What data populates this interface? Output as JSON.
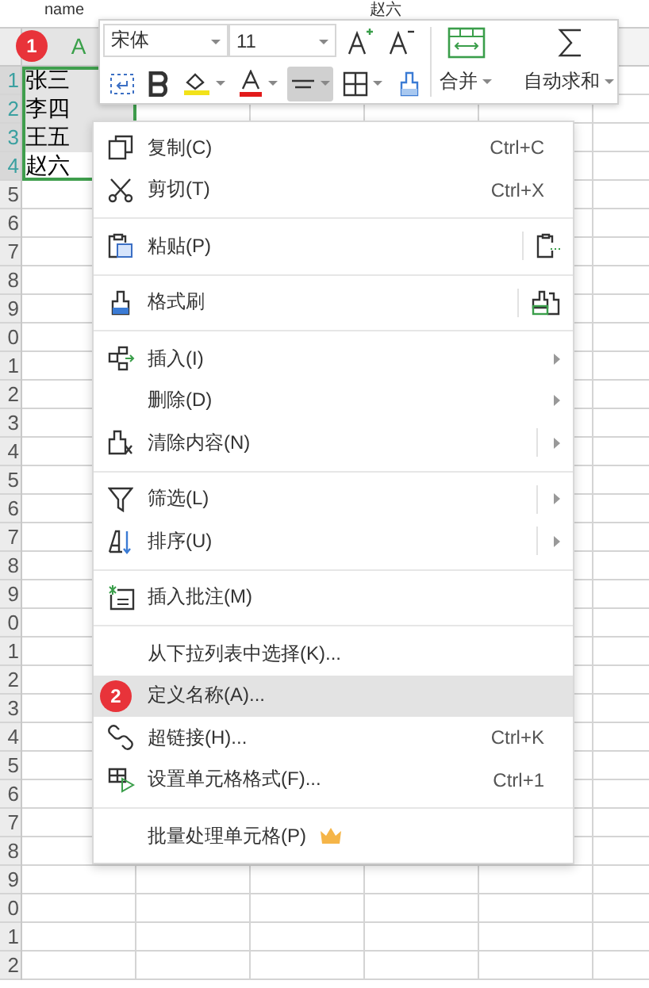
{
  "formula_bar": {
    "name_box": "name",
    "cell_content": "赵六"
  },
  "sheet": {
    "columns": [
      {
        "label": "A",
        "selected": true
      }
    ],
    "row_headers": [
      {
        "label": "1",
        "selected": true
      },
      {
        "label": "2",
        "selected": true
      },
      {
        "label": "3",
        "selected": true
      },
      {
        "label": "4",
        "selected": true
      },
      {
        "label": "5",
        "selected": false
      },
      {
        "label": "6",
        "selected": false
      },
      {
        "label": "7",
        "selected": false
      },
      {
        "label": "8",
        "selected": false
      },
      {
        "label": "9",
        "selected": false
      },
      {
        "label": "0",
        "selected": false
      },
      {
        "label": "1",
        "selected": false
      },
      {
        "label": "2",
        "selected": false
      },
      {
        "label": "3",
        "selected": false
      },
      {
        "label": "4",
        "selected": false
      },
      {
        "label": "5",
        "selected": false
      },
      {
        "label": "6",
        "selected": false
      },
      {
        "label": "7",
        "selected": false
      },
      {
        "label": "8",
        "selected": false
      },
      {
        "label": "9",
        "selected": false
      },
      {
        "label": "0",
        "selected": false
      },
      {
        "label": "1",
        "selected": false
      },
      {
        "label": "2",
        "selected": false
      },
      {
        "label": "3",
        "selected": false
      },
      {
        "label": "4",
        "selected": false
      },
      {
        "label": "5",
        "selected": false
      },
      {
        "label": "6",
        "selected": false
      },
      {
        "label": "7",
        "selected": false
      },
      {
        "label": "8",
        "selected": false
      },
      {
        "label": "9",
        "selected": false
      },
      {
        "label": "0",
        "selected": false
      },
      {
        "label": "1",
        "selected": false
      },
      {
        "label": "2",
        "selected": false
      }
    ],
    "cells": [
      {
        "text": "张三",
        "selected": true
      },
      {
        "text": "李四",
        "selected": true
      },
      {
        "text": "王五",
        "selected": true
      },
      {
        "text": "赵六",
        "selected": false
      }
    ]
  },
  "toolbar": {
    "font_field": "宋体",
    "size_field": "11",
    "align_pressed": true,
    "merge_label": "合并",
    "autosum_label": "自动求和"
  },
  "context_menu": {
    "sections": [
      [
        {
          "label": "复制(C)",
          "shortcut": "Ctrl+C",
          "submenu": false,
          "selected": false
        },
        {
          "label": "剪切(T)",
          "shortcut": "Ctrl+X",
          "submenu": false,
          "selected": false
        }
      ],
      [
        {
          "label": "粘贴(P)",
          "submenu": false,
          "selected": false
        }
      ],
      [
        {
          "label": "格式刷",
          "submenu": false,
          "selected": false
        }
      ],
      [
        {
          "label": "插入(I)",
          "submenu": true,
          "selected": false
        },
        {
          "label": "删除(D)",
          "submenu": true,
          "selected": false
        },
        {
          "label": "清除内容(N)",
          "submenu": true,
          "selected": false
        }
      ],
      [
        {
          "label": "筛选(L)",
          "submenu": true,
          "selected": false
        },
        {
          "label": "排序(U)",
          "submenu": true,
          "selected": false
        }
      ],
      [
        {
          "label": "插入批注(M)",
          "submenu": false,
          "selected": false
        }
      ],
      [
        {
          "label": "从下拉列表中选择(K)...",
          "submenu": false,
          "selected": false
        },
        {
          "label": "定义名称(A)...",
          "submenu": false,
          "selected": true
        },
        {
          "label": "超链接(H)...",
          "shortcut": "Ctrl+K",
          "submenu": false,
          "selected": false
        },
        {
          "label": "设置单元格格式(F)...",
          "shortcut": "Ctrl+1",
          "submenu": false,
          "selected": false
        }
      ],
      [
        {
          "label": "批量处理单元格(P)",
          "submenu": false,
          "selected": false,
          "premium": true
        }
      ]
    ]
  },
  "badges": [
    {
      "text": "1"
    },
    {
      "text": "2"
    }
  ]
}
